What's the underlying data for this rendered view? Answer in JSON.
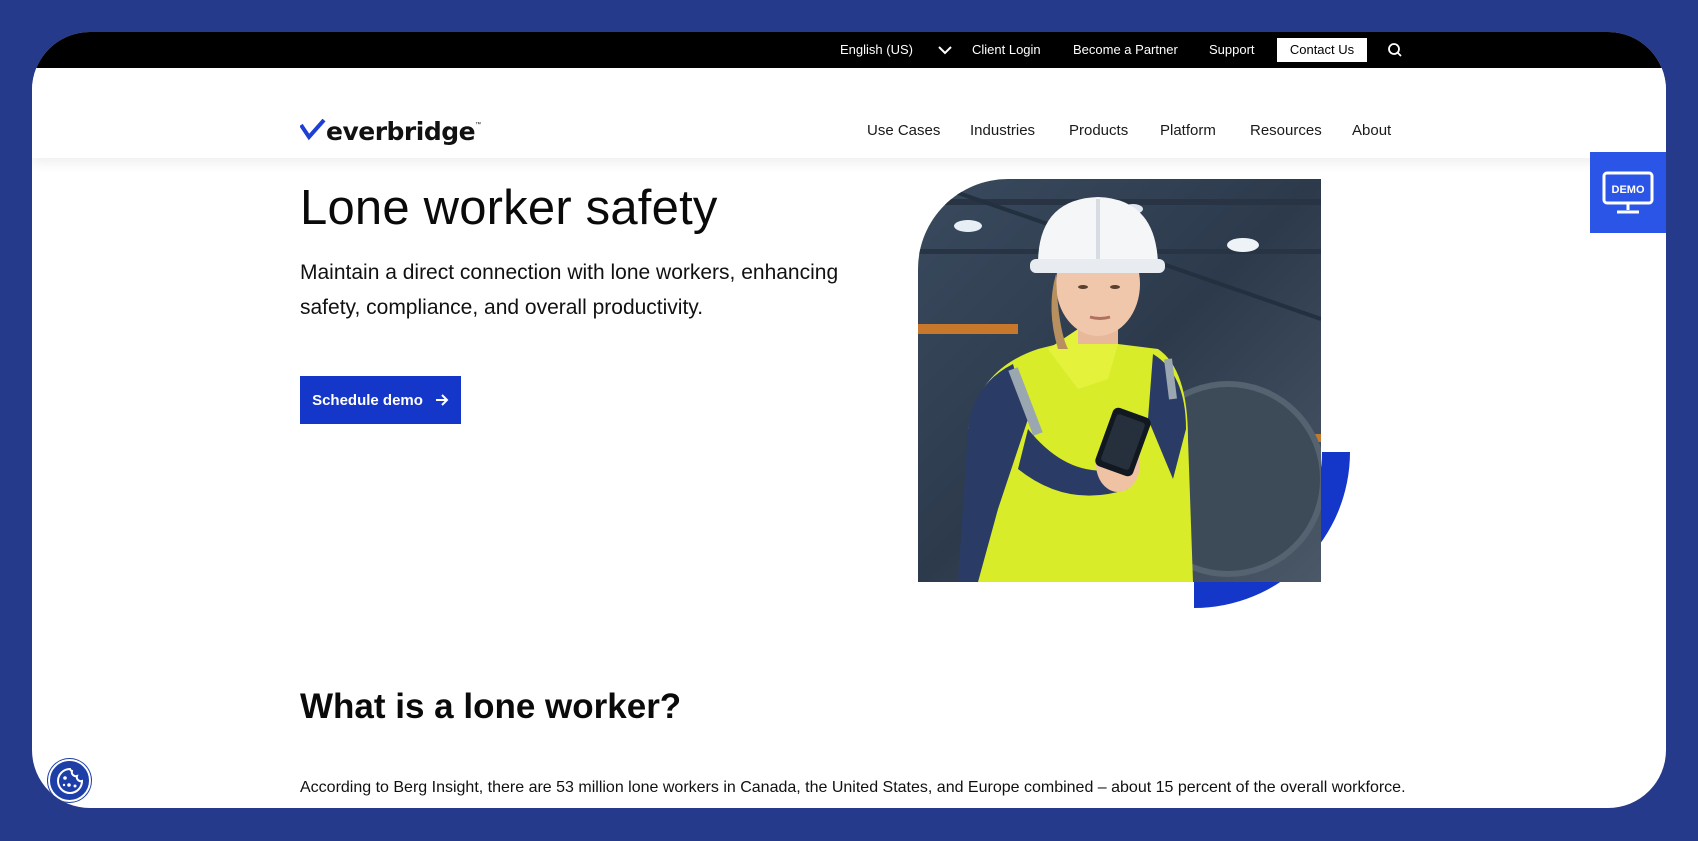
{
  "topbar": {
    "language": "English (US)",
    "client_login": "Client Login",
    "become_partner": "Become a Partner",
    "support": "Support",
    "contact_us": "Contact Us"
  },
  "logo": {
    "text": "everbridge",
    "tm": "™"
  },
  "nav": {
    "items": [
      "Use Cases",
      "Industries",
      "Products",
      "Platform",
      "Resources",
      "About"
    ]
  },
  "hero": {
    "title": "Lone worker safety",
    "subtitle": "Maintain a direct connection with lone workers, enhancing safety, compliance, and overall productivity.",
    "cta": "Schedule demo"
  },
  "demo_tab": {
    "label": "DEMO"
  },
  "section": {
    "title": "What is a lone worker?",
    "body": "According to Berg Insight, there are 53 million lone workers in Canada, the United States, and Europe combined – about 15 percent of the overall workforce."
  },
  "colors": {
    "page_bg": "#263a8c",
    "accent": "#1437c9",
    "demo_tab": "#2a55e6"
  },
  "icons": {
    "search": "search-icon",
    "chevron": "chevron-down-icon",
    "arrow": "arrow-right-icon",
    "monitor": "monitor-icon",
    "cookie": "cookie-icon"
  }
}
